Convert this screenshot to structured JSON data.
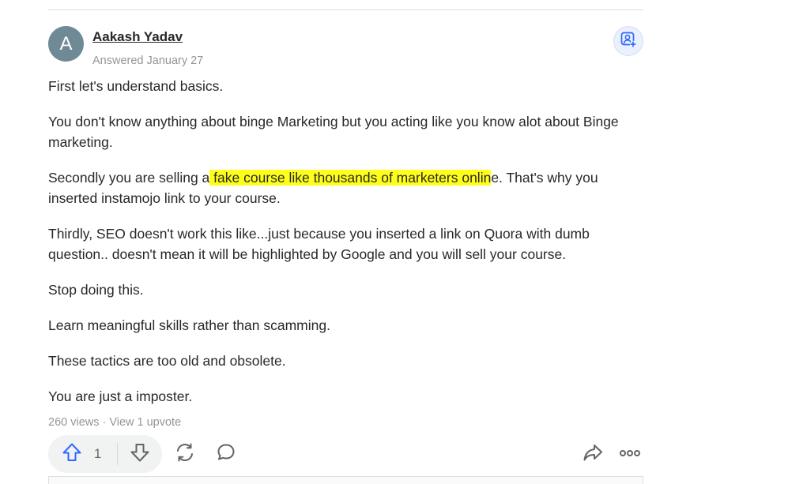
{
  "author": {
    "avatar_initial": "A",
    "name": "Aakash Yadav",
    "meta": "Answered January 27"
  },
  "answer": {
    "paragraphs": [
      {
        "text": "First let's understand basics."
      },
      {
        "text": "You don't know anything about binge Marketing but you acting like you know alot about Binge marketing."
      },
      {
        "before": "Secondly you are selling a",
        "highlight": " fake course like thousands of marketers onlin",
        "after": "e. That's why you inserted instamojo link to your course."
      },
      {
        "text": "Thirdly, SEO doesn't work this like...just because you inserted a link on Quora with dumb question.. doesn't mean it will be highlighted by Google and you will sell your course."
      },
      {
        "text": "Stop doing this."
      },
      {
        "text": "Learn meaningful skills rather than scamming."
      },
      {
        "text": "These tactics are too old and obsolete."
      },
      {
        "text": "You are just a imposter."
      }
    ]
  },
  "stats": {
    "views": "260 views",
    "separator": "·",
    "upvotes_link": "View 1 upvote"
  },
  "actions": {
    "upvote_count": "1",
    "upvote_icon": "arrow-up-icon",
    "downvote_icon": "arrow-down-icon",
    "share_icon": "refresh-icon",
    "comment_icon": "comment-icon",
    "forward_icon": "share-arrow-icon",
    "more_icon": "more-dots-icon",
    "follow_icon": "person-add-icon"
  },
  "colors": {
    "highlight": "#ffff1a",
    "accent": "#2e69ff",
    "muted": "#939598",
    "avatar": "#6f8a96"
  }
}
